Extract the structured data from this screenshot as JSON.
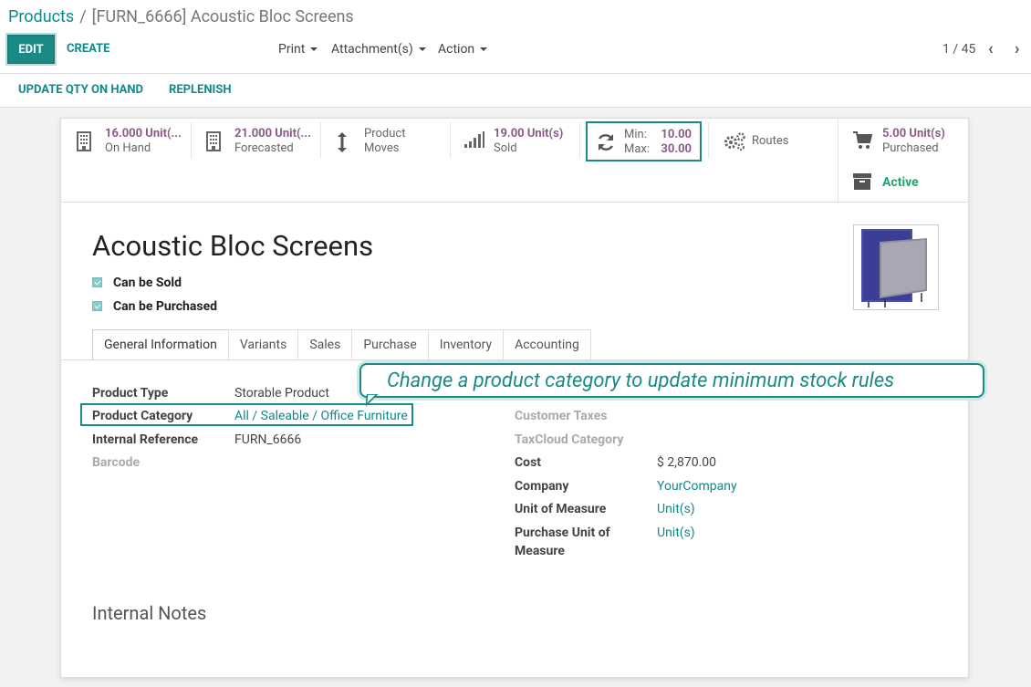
{
  "breadcrumb": {
    "parent": "Products",
    "separator": "/",
    "current": "[FURN_6666] Acoustic Bloc Screens"
  },
  "toolbar": {
    "edit": "EDIT",
    "create": "CREATE",
    "print": "Print",
    "attachments": "Attachment(s)",
    "action": "Action",
    "pager": "1 / 45"
  },
  "actions": {
    "update_qty": "UPDATE QTY ON HAND",
    "replenish": "REPLENISH"
  },
  "smart_buttons": {
    "on_hand": {
      "value": "16.000 Unit(...",
      "label": "On Hand"
    },
    "forecasted": {
      "value": "21.000 Unit(...",
      "label": "Forecasted"
    },
    "moves": {
      "line1": "Product",
      "line2": "Moves"
    },
    "sold": {
      "value": "19.00 Unit(s)",
      "label": "Sold"
    },
    "minmax": {
      "min_label": "Min:",
      "min_value": "10.00",
      "max_label": "Max:",
      "max_value": "30.00"
    },
    "routes": {
      "label": "Routes"
    },
    "purchased": {
      "value": "5.00 Unit(s)",
      "label": "Purchased"
    },
    "active": {
      "label": "Active"
    }
  },
  "product": {
    "name": "Acoustic Bloc Screens",
    "can_be_sold": "Can be Sold",
    "can_be_purchased": "Can be Purchased"
  },
  "tabs": [
    "General Information",
    "Variants",
    "Sales",
    "Purchase",
    "Inventory",
    "Accounting"
  ],
  "callout": "Change a product category to update minimum stock rules",
  "fields_left": {
    "product_type": {
      "label": "Product Type",
      "value": "Storable Product"
    },
    "product_category": {
      "label": "Product Category",
      "value": "All / Saleable / Office Furniture"
    },
    "internal_reference": {
      "label": "Internal Reference",
      "value": "FURN_6666"
    },
    "barcode": {
      "label": "Barcode"
    }
  },
  "fields_right": {
    "customer_taxes": {
      "label": "Customer Taxes"
    },
    "taxcloud_category": {
      "label": "TaxCloud Category"
    },
    "cost": {
      "label": "Cost",
      "value": "$ 2,870.00"
    },
    "company": {
      "label": "Company",
      "value": "YourCompany"
    },
    "uom": {
      "label": "Unit of Measure",
      "value": "Unit(s)"
    },
    "purchase_uom": {
      "label_line1": "Purchase Unit of",
      "label_line2": "Measure",
      "value": "Unit(s)"
    }
  },
  "notes": {
    "heading": "Internal Notes"
  },
  "colors": {
    "accent": "#1a8a87",
    "link": "#0f8a8a",
    "stat_value": "#8b5a8b",
    "active": "#21a56d"
  }
}
